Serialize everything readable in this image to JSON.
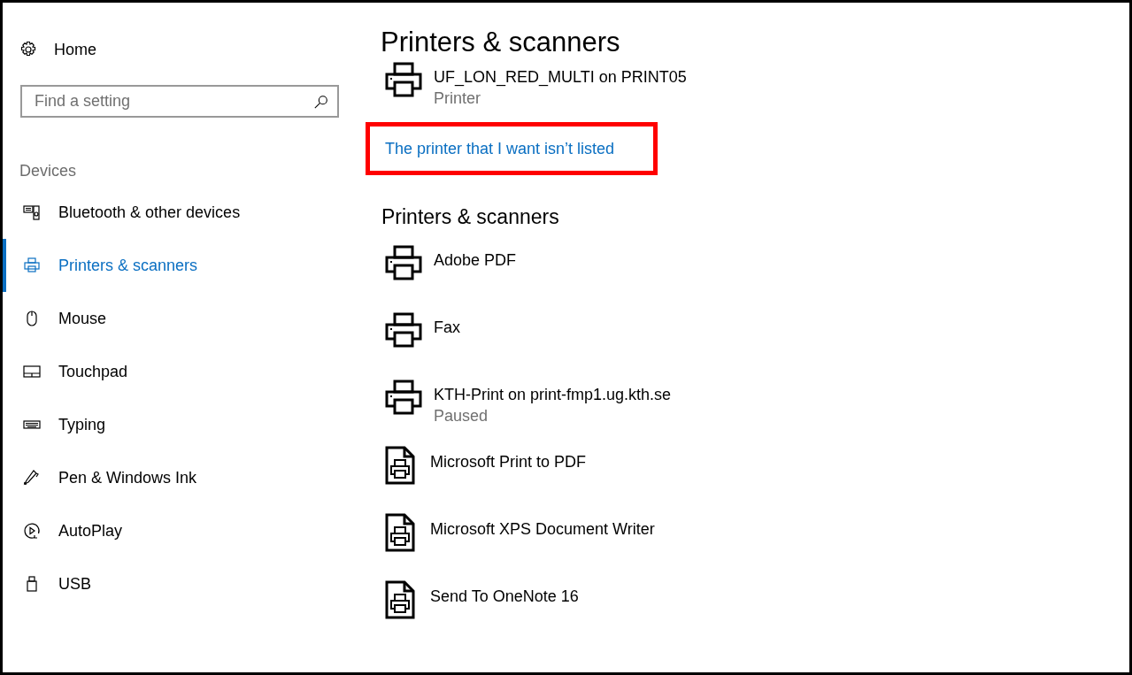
{
  "sidebar": {
    "home": "Home",
    "search": {
      "placeholder": "Find a setting"
    },
    "section": "Devices",
    "items": [
      {
        "label": "Bluetooth & other devices",
        "kind": "bluetooth",
        "selected": false
      },
      {
        "label": "Printers & scanners",
        "kind": "printer",
        "selected": true
      },
      {
        "label": "Mouse",
        "kind": "mouse",
        "selected": false
      },
      {
        "label": "Touchpad",
        "kind": "touchpad",
        "selected": false
      },
      {
        "label": "Typing",
        "kind": "typing",
        "selected": false
      },
      {
        "label": "Pen & Windows Ink",
        "kind": "pen",
        "selected": false
      },
      {
        "label": "AutoPlay",
        "kind": "autoplay",
        "selected": false
      },
      {
        "label": "USB",
        "kind": "usb",
        "selected": false
      }
    ]
  },
  "main": {
    "title": "Printers & scanners",
    "top_devices": [
      {
        "name": "UF_LON_RED_MULTI on PRINT05",
        "status": "Printer",
        "kind": "printer"
      }
    ],
    "link": {
      "text": "The printer that I want isn’t listed",
      "highlighted": true
    },
    "section_title": "Printers & scanners",
    "devices": [
      {
        "name": "Adobe PDF",
        "kind": "printer"
      },
      {
        "name": "Fax",
        "kind": "printer"
      },
      {
        "name": "KTH-Print on print-fmp1.ug.kth.se",
        "status": "Paused",
        "kind": "printer"
      },
      {
        "name": "Microsoft Print to PDF",
        "kind": "document"
      },
      {
        "name": "Microsoft XPS Document Writer",
        "kind": "document"
      },
      {
        "name": "Send To OneNote 16",
        "kind": "document"
      }
    ]
  }
}
